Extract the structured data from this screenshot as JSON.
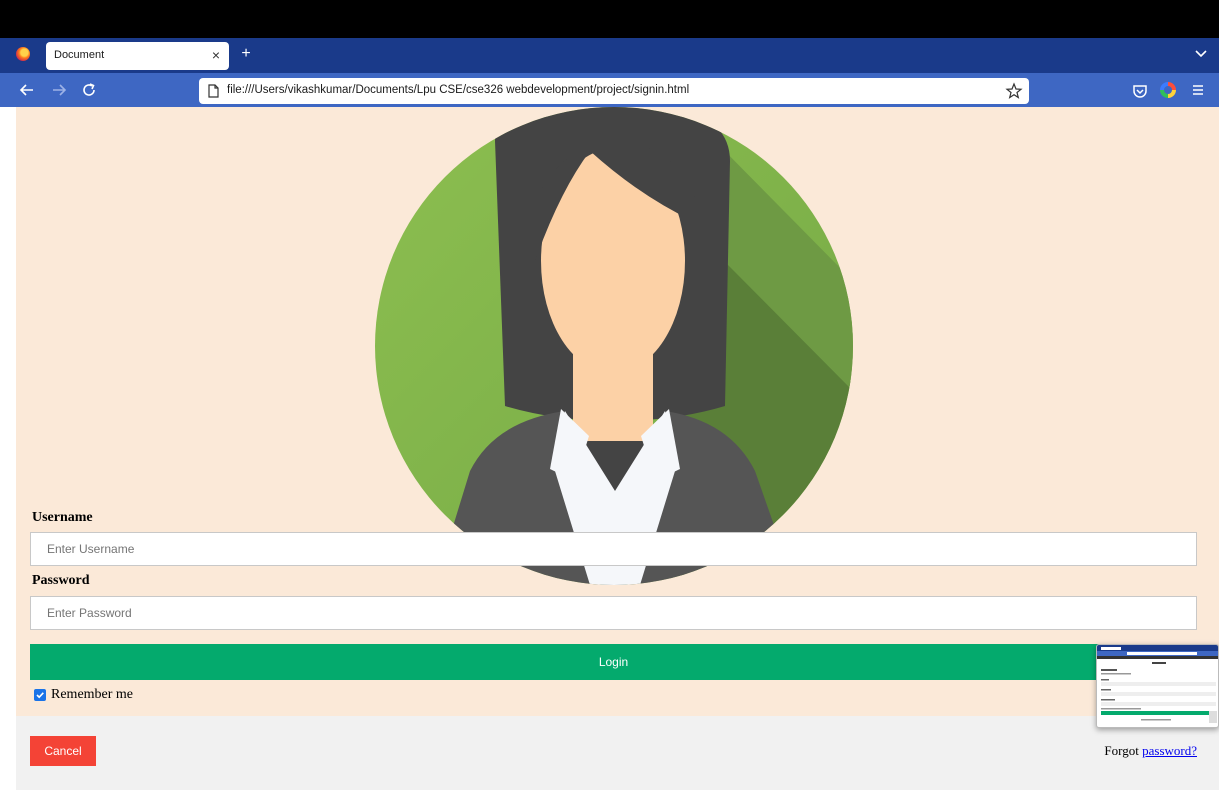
{
  "browser": {
    "tab_title": "Document",
    "tab_close": "×",
    "new_tab": "+",
    "url": "file:///Users/vikashkumar/Documents/Lpu CSE/cse326 webdevelopment/project/signin.html",
    "icons": [
      "firefox-logo-icon",
      "back-arrow-icon",
      "forward-arrow-icon",
      "reload-icon",
      "page-icon",
      "bookmark-star-icon",
      "pocket-icon",
      "extension-icon",
      "hamburger-menu-icon",
      "tabs-dropdown-icon"
    ]
  },
  "form": {
    "username_label": "Username",
    "username_placeholder": "Enter Username",
    "password_label": "Password",
    "password_placeholder": "Enter Password",
    "login_label": "Login",
    "remember_label": "Remember me",
    "remember_checked": true,
    "cancel_label": "Cancel",
    "forgot_prefix": "Forgot",
    "forgot_link": "password?"
  },
  "colors": {
    "page_bg": "#fbe9d8",
    "login_green": "#04aa6d",
    "cancel_red": "#f44336",
    "tab_strip": "#1a3a8a",
    "nav_bar": "#3e67c3",
    "avatar_green": "#8dbf50"
  }
}
